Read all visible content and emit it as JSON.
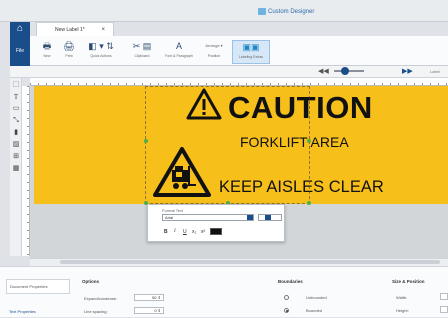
{
  "app": {
    "title": "Custom Designer"
  },
  "tabs": [
    {
      "label": "New Label 1*",
      "close": "×"
    }
  ],
  "ribbon": {
    "file": "File",
    "buttons": [
      {
        "label": "New",
        "icon": "new-icon"
      },
      {
        "label": "Print",
        "icon": "print-icon"
      },
      {
        "label": "Quick Actions",
        "icon": "quick-actions-icon"
      },
      {
        "label": "Clipboard",
        "icon": "clipboard-icon"
      },
      {
        "label": "Font & Paragraph",
        "icon": "font-icon"
      },
      {
        "label": "Arrange ▾",
        "icon": "arrange-icon"
      },
      {
        "label": "Position",
        "icon": "position-icon"
      },
      {
        "label": "Labeling Extras",
        "icon": "labeling-extras-icon"
      }
    ]
  },
  "nav": {
    "label": "Label"
  },
  "label": {
    "caution": "CAUTION",
    "line1": "FORKLIFT AREA",
    "line2": "KEEP AISLES CLEAR",
    "color": "#f6bf1a"
  },
  "format_popup": {
    "title": "Format Text",
    "font": "Arial",
    "bold": "B",
    "italic": "I",
    "underline": "U",
    "sub": "x₂",
    "sup": "x²"
  },
  "properties": {
    "tabs": [
      {
        "label": "Document Properties"
      },
      {
        "label": "Text Properties"
      }
    ],
    "options": {
      "title": "Options",
      "fields": [
        {
          "label": "Expand/condense:",
          "value": "50 ⇕"
        },
        {
          "label": "Line spacing:",
          "value": "0 ⇕"
        }
      ]
    },
    "boundaries": {
      "title": "Boundaries",
      "options": [
        {
          "label": "Unbounded",
          "selected": false
        },
        {
          "label": "Bounded",
          "selected": true
        }
      ]
    },
    "size_position": {
      "title": "Size & Position",
      "fields": [
        {
          "label": "Width:"
        },
        {
          "label": "Height:"
        }
      ]
    }
  }
}
